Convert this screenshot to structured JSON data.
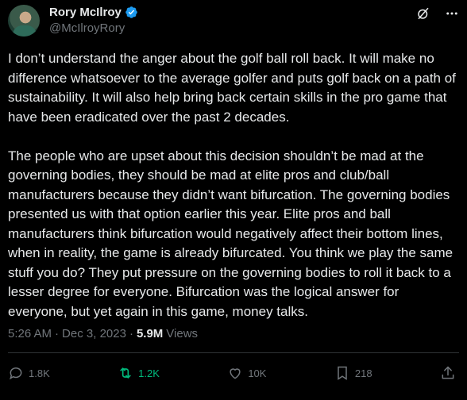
{
  "author": {
    "display_name": "Rory McIlroy",
    "handle": "@McIlroyRory",
    "verified": true
  },
  "tweet": {
    "text": "I don’t understand the anger about the golf ball roll back. It will make no difference whatsoever to the average golfer and puts golf back on a path of sustainability. It will also help bring back certain skills in the pro game that have been eradicated over the past 2 decades.\n\nThe people who are upset about this decision shouldn’t be mad at the governing bodies, they should be mad at elite pros and club/ball manufacturers because they didn’t want bifurcation. The governing bodies presented us with that option earlier this year. Elite pros and ball manufacturers think bifurcation would negatively affect their bottom lines, when in reality, the game is already bifurcated. You think we play the same stuff you do? They put pressure on the governing bodies to roll it back to a lesser degree for everyone. Bifurcation was the logical answer for everyone, but yet again in this game, money talks.",
    "time": "5:26 AM",
    "separator": "·",
    "date": "Dec 3, 2023",
    "views_count": "5.9M",
    "views_label": "Views"
  },
  "actions": {
    "replies": "1.8K",
    "retweets": "1.2K",
    "likes": "10K",
    "bookmarks": "218"
  },
  "icons": {
    "verified": "verified-badge-icon",
    "grok": "grok-icon",
    "more": "more-icon",
    "reply": "reply-icon",
    "retweet": "retweet-icon",
    "like": "heart-icon",
    "bookmark": "bookmark-icon",
    "share": "share-icon"
  },
  "colors": {
    "background": "#000000",
    "text": "#e7e9ea",
    "muted": "#71767b",
    "verified": "#1d9bf0",
    "retweet_active": "#00ba7c"
  }
}
